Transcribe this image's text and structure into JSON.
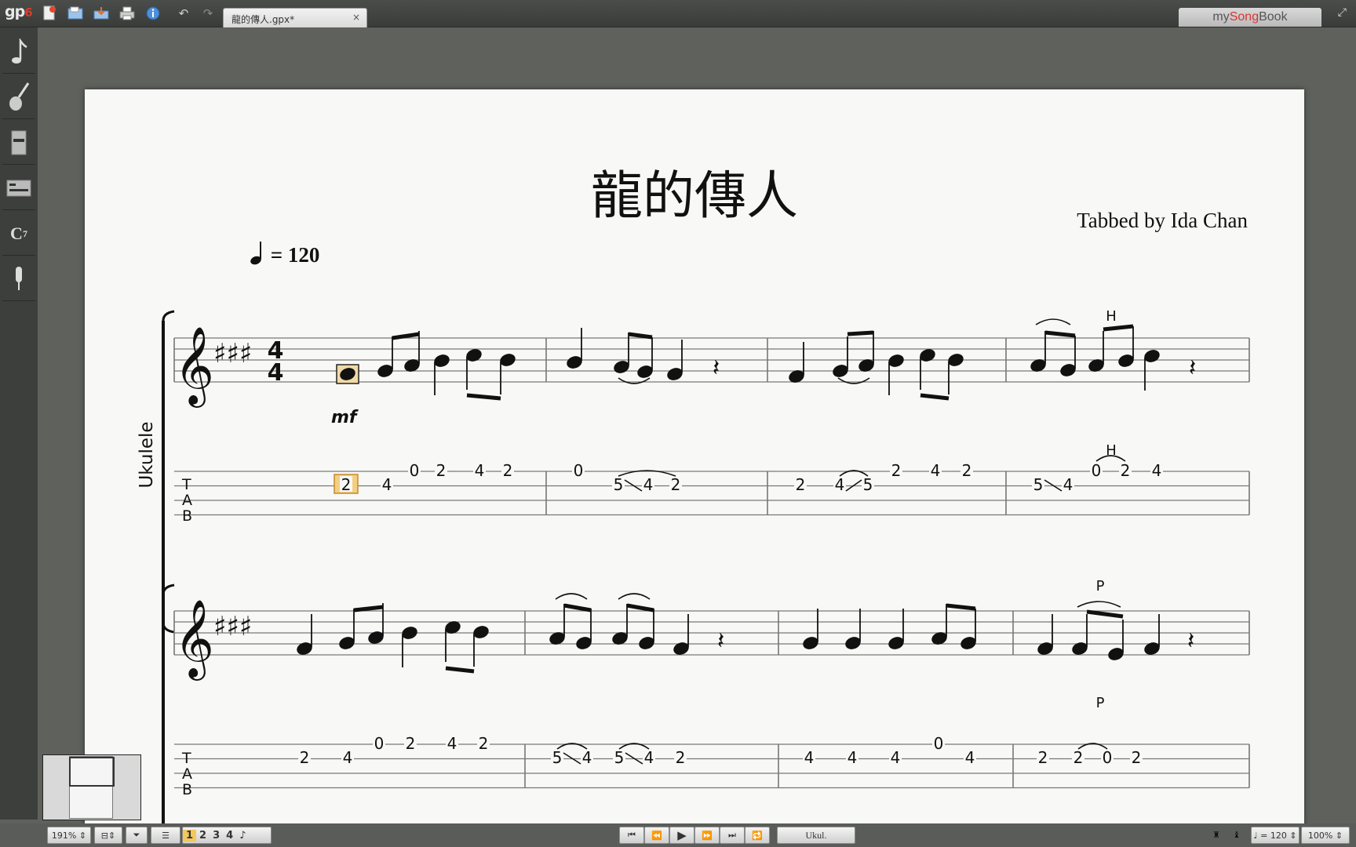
{
  "app": {
    "logo": "gp",
    "logo_version": "6"
  },
  "tab": {
    "label": "龍的傳人.gpx*",
    "close": "×"
  },
  "mysongbook": {
    "prefix": "my",
    "accent": "Song",
    "suffix": "Book"
  },
  "score": {
    "title": "龍的傳人",
    "credit": "Tabbed by Ida Chan",
    "tempo_value": "= 120",
    "instrument": "Ukulele",
    "time_signature": [
      "4",
      "4"
    ],
    "dynamic": "mf",
    "tab_letters": [
      "T",
      "A",
      "B"
    ],
    "system1": {
      "technique_labels": [
        "H",
        "H"
      ],
      "fret_numbers": [
        "2",
        "4",
        "0",
        "2",
        "4",
        "2",
        "0",
        "5",
        "4",
        "2",
        "2",
        "4",
        "5",
        "2",
        "4",
        "2",
        "5",
        "4",
        "0",
        "2",
        "4"
      ]
    },
    "system2": {
      "technique_labels": [
        "P",
        "P"
      ],
      "fret_numbers": [
        "2",
        "4",
        "0",
        "2",
        "4",
        "2",
        "5",
        "4",
        "5",
        "4",
        "2",
        "4",
        "4",
        "4",
        "0",
        "4",
        "2",
        "2",
        "0",
        "2"
      ]
    }
  },
  "bottombar": {
    "zoom": "191%",
    "pages": [
      "1",
      "2",
      "3",
      "4"
    ],
    "active_page": "1",
    "track": "Ukul.",
    "tempo": "♩ = 120",
    "volume": "100%"
  }
}
